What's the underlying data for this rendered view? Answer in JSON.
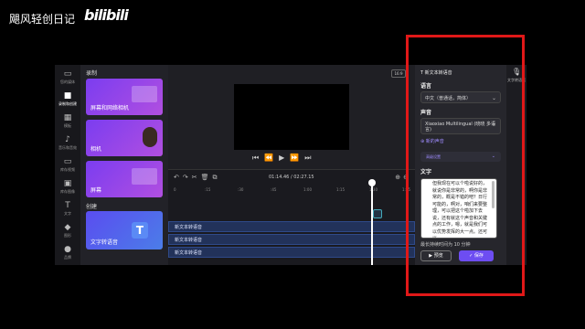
{
  "watermark": {
    "channel": "飓风轻创日记",
    "brand": "bilibili"
  },
  "rail": {
    "items": [
      {
        "label": "您的媒体",
        "icon": "folder-icon"
      },
      {
        "label": "录制和创建",
        "icon": "camera-icon"
      },
      {
        "label": "模板",
        "icon": "grid-icon"
      },
      {
        "label": "音乐和音效",
        "icon": "music-icon"
      },
      {
        "label": "库存视频",
        "icon": "film-icon"
      },
      {
        "label": "库存图像",
        "icon": "image-icon"
      },
      {
        "label": "文字",
        "icon": "text-icon"
      },
      {
        "label": "图形",
        "icon": "shapes-icon"
      },
      {
        "label": "品牌",
        "icon": "brand-icon"
      }
    ]
  },
  "media_panel": {
    "record_title": "录制",
    "cards": [
      "屏幕和网络相机",
      "相机",
      "屏幕"
    ],
    "create_title": "创建",
    "tts_card": "文字转语音"
  },
  "toolbar": {
    "ratio": "16:9"
  },
  "timeline": {
    "time": "01:14.46 / 02:27.15",
    "ticks": [
      "0",
      ":15",
      ":30",
      ":45",
      "1:00",
      "1:15",
      "1:30",
      "1:45"
    ],
    "tracks": [
      "新文本转语音",
      "新文本转语音",
      "新文本转语音"
    ]
  },
  "tts_panel": {
    "header": "新文本转语音",
    "language_label": "语言",
    "language_value": "中文（普通话，简体）",
    "voice_label": "声音",
    "voice_value": "Xiaoxiao Multilingual (晓晓 多语言)",
    "new_voice": "新的声音",
    "advanced": "高级设置",
    "text_label": "文字",
    "text_value": "但我现在可以个啦说好的，就说你是非常的，啊你是非常的，概是不错的吧？日行可能的，啊对，咱们来要整理，可以把这个啦加下去说，还有就这个声音和关键点的工作，嗯，就是我们可以优势发挥的大一点。还可以",
    "limit": "最长持续时间为 10 分钟",
    "preview_btn": "预览",
    "save_btn": "保存"
  },
  "right_rail": {
    "label": "文字转语音"
  },
  "colors": {
    "accent": "#6d4df2",
    "highlight": "#e01818",
    "track": "#22325a"
  }
}
